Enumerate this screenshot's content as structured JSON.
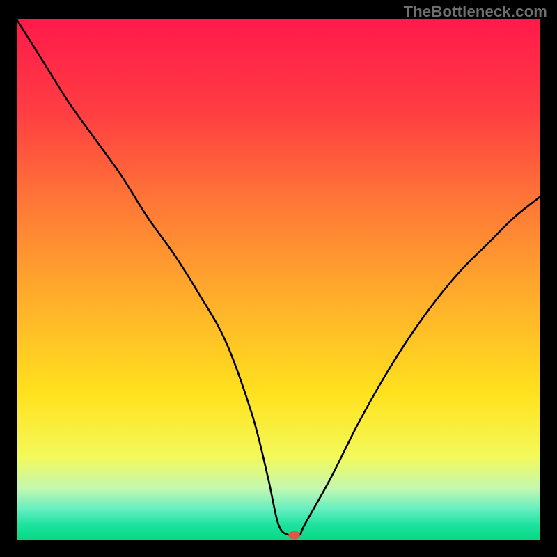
{
  "watermark": "TheBottleneck.com",
  "chart_data": {
    "type": "line",
    "title": "",
    "xlabel": "",
    "ylabel": "",
    "xlim": [
      0,
      100
    ],
    "ylim": [
      0,
      100
    ],
    "grid": false,
    "legend": false,
    "series": [
      {
        "name": "bottleneck-curve",
        "x": [
          0,
          5,
          10,
          15,
          20,
          25,
          30,
          35,
          40,
          45,
          48,
          50,
          52,
          54,
          55,
          60,
          65,
          70,
          75,
          80,
          85,
          90,
          95,
          100
        ],
        "y": [
          100,
          92,
          84,
          77,
          70,
          62,
          55,
          47,
          38,
          24,
          12,
          3,
          1,
          1,
          3,
          12,
          22,
          31,
          39,
          46,
          52,
          57,
          62,
          66
        ]
      }
    ],
    "marker": {
      "x": 53,
      "y": 1,
      "color": "#e2554b"
    },
    "background_gradient": {
      "stops": [
        {
          "pos": 0.0,
          "color": "#ff1a4b"
        },
        {
          "pos": 0.18,
          "color": "#ff3e42"
        },
        {
          "pos": 0.36,
          "color": "#ff7a36"
        },
        {
          "pos": 0.55,
          "color": "#ffb22a"
        },
        {
          "pos": 0.72,
          "color": "#ffe21e"
        },
        {
          "pos": 0.84,
          "color": "#f3f95a"
        },
        {
          "pos": 0.9,
          "color": "#c4f8b0"
        },
        {
          "pos": 0.94,
          "color": "#66eec0"
        },
        {
          "pos": 0.97,
          "color": "#1de39f"
        },
        {
          "pos": 1.0,
          "color": "#07d884"
        }
      ]
    }
  }
}
